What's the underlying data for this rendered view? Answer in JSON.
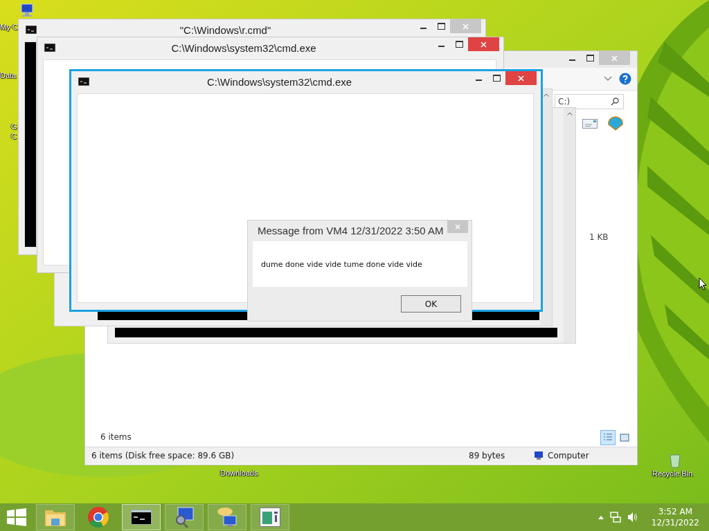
{
  "desktop_icons": [
    {
      "label": "My C"
    },
    {
      "label": "Data"
    },
    {
      "label": "G"
    },
    {
      "label": "C"
    },
    {
      "label": "Downloads"
    },
    {
      "label": "Recycle Bin"
    }
  ],
  "explorer": {
    "search_text": "C:)",
    "size": "1 KB",
    "item_count": "6 items",
    "status": "6 items (Disk free space: 89.6 GB)",
    "selection_size": "89 bytes",
    "location": "Computer",
    "details_view": true
  },
  "console_windows": [
    {
      "title": "\"C:\\Windows\\r.cmd\"",
      "active": false,
      "close_highlighted": false
    },
    {
      "title": "C:\\Windows\\system32\\cmd.exe",
      "active": false,
      "close_highlighted": true
    },
    {
      "title": "C:\\Windows\\system32\\cmd.exe",
      "active": true,
      "close_highlighted": true
    }
  ],
  "dialog": {
    "title": "Message from VM4 12/31/2022 3:50 AM",
    "message": "dume done vide vide tume done vide vide",
    "button": "OK"
  },
  "taskbar": {
    "apps": [
      {
        "kind": "folder",
        "selected": false
      },
      {
        "kind": "browser",
        "selected": false
      },
      {
        "kind": "console",
        "selected": true
      },
      {
        "kind": "monitor",
        "selected": false
      },
      {
        "kind": "chat",
        "selected": false
      },
      {
        "kind": "window",
        "selected": false
      }
    ],
    "time": "3:52 AM",
    "date": "12/31/2022"
  }
}
